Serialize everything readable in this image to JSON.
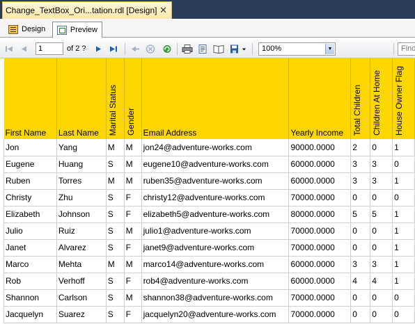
{
  "doc_tab": {
    "title": "Change_TextBox_Ori...tation.rdl [Design]",
    "close": "✕"
  },
  "view_tabs": {
    "design": "Design",
    "preview": "Preview"
  },
  "toolbar": {
    "page": "1",
    "of_label": "of  2 ?",
    "zoom": "100%",
    "find": "Find"
  },
  "report": {
    "columns": [
      "First Name",
      "Last Name",
      "Marital Status",
      "Gender",
      "Email Address",
      "Yearly Income",
      "Total Children",
      "Children At Home",
      "House Owner Flag"
    ],
    "rows": [
      [
        "Jon",
        "Yang",
        "M",
        "M",
        "jon24@adventure-works.com",
        "90000.0000",
        "2",
        "0",
        "1"
      ],
      [
        "Eugene",
        "Huang",
        "S",
        "M",
        "eugene10@adventure-works.com",
        "60000.0000",
        "3",
        "3",
        "0"
      ],
      [
        "Ruben",
        "Torres",
        "M",
        "M",
        "ruben35@adventure-works.com",
        "60000.0000",
        "3",
        "3",
        "1"
      ],
      [
        "Christy",
        "Zhu",
        "S",
        "F",
        "christy12@adventure-works.com",
        "70000.0000",
        "0",
        "0",
        "0"
      ],
      [
        "Elizabeth",
        "Johnson",
        "S",
        "F",
        "elizabeth5@adventure-works.com",
        "80000.0000",
        "5",
        "5",
        "1"
      ],
      [
        "Julio",
        "Ruiz",
        "S",
        "M",
        "julio1@adventure-works.com",
        "70000.0000",
        "0",
        "0",
        "1"
      ],
      [
        "Janet",
        "Alvarez",
        "S",
        "F",
        "janet9@adventure-works.com",
        "70000.0000",
        "0",
        "0",
        "1"
      ],
      [
        "Marco",
        "Mehta",
        "M",
        "M",
        "marco14@adventure-works.com",
        "60000.0000",
        "3",
        "3",
        "1"
      ],
      [
        "Rob",
        "Verhoff",
        "S",
        "F",
        "rob4@adventure-works.com",
        "60000.0000",
        "4",
        "4",
        "1"
      ],
      [
        "Shannon",
        "Carlson",
        "S",
        "M",
        "shannon38@adventure-works.com",
        "70000.0000",
        "0",
        "0",
        "0"
      ],
      [
        "Jacquelyn",
        "Suarez",
        "S",
        "F",
        "jacquelyn20@adventure-works.com",
        "70000.0000",
        "0",
        "0",
        "0"
      ]
    ]
  }
}
